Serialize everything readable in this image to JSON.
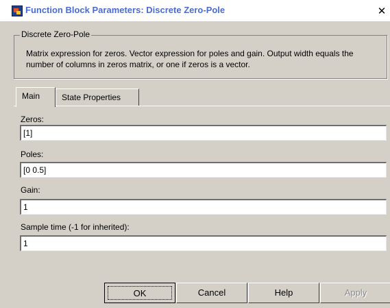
{
  "window": {
    "title": "Function Block Parameters: Discrete Zero-Pole",
    "close_glyph": "✕"
  },
  "group": {
    "title": "Discrete Zero-Pole",
    "description": "Matrix expression for zeros.  Vector expression for poles and gain. Output width equals the number of columns in zeros matrix, or one if zeros is a vector."
  },
  "tabs": [
    {
      "label": "Main",
      "selected": true
    },
    {
      "label": "State Properties",
      "selected": false
    }
  ],
  "fields": {
    "zeros": {
      "label": "Zeros:",
      "value": "[1]"
    },
    "poles": {
      "label": "Poles:",
      "value": "[0 0.5]"
    },
    "gain": {
      "label": "Gain:",
      "value": "1"
    },
    "sample_time": {
      "label": "Sample time (-1 for inherited):",
      "value": "1"
    }
  },
  "buttons": {
    "ok": "OK",
    "cancel": "Cancel",
    "help": "Help",
    "apply": "Apply",
    "apply_enabled": false
  },
  "colors": {
    "dialog_bg": "#d4d0c8",
    "title_text": "#4a6bd0",
    "disabled_text": "#8c8c8c"
  },
  "icons": {
    "app": "simulink-block-icon",
    "close": "close-icon"
  }
}
